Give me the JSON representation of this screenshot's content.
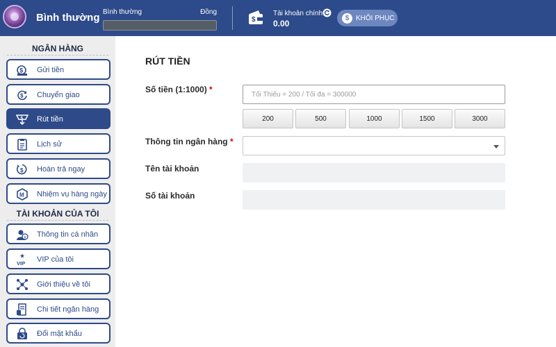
{
  "header": {
    "rank_title": "Bình thường",
    "rank_label": "Bình thường",
    "next_rank_label": "Đồng",
    "progress": 0,
    "account_label": "Tài khoản chính",
    "balance": "0.00",
    "restore_label": "KHÔI PHỤC",
    "restore_icon_text": "$"
  },
  "sidebar": {
    "bank_section": "NGÂN HÀNG",
    "bank_items": [
      {
        "label": "Gửi tiền",
        "icon": "deposit-icon"
      },
      {
        "label": "Chuyển giao",
        "icon": "transfer-icon"
      },
      {
        "label": "Rút tiền",
        "icon": "withdraw-icon",
        "active": true
      },
      {
        "label": "Lịch sử",
        "icon": "history-icon"
      },
      {
        "label": "Hoàn trả ngay",
        "icon": "rebate-icon"
      },
      {
        "label": "Nhiệm vụ hàng ngày",
        "icon": "daily-mission-icon"
      }
    ],
    "account_section": "TÀI KHOẢN CỦA TÔI",
    "account_items": [
      {
        "label": "Thông tin cá nhân",
        "icon": "profile-icon"
      },
      {
        "label": "VIP của tôi",
        "icon": "vip-icon"
      },
      {
        "label": "Giới thiệu về tôi",
        "icon": "referral-icon"
      },
      {
        "label": "Chi tiết ngân hàng",
        "icon": "bank-details-icon"
      },
      {
        "label": "Đổi mật khẩu",
        "icon": "change-password-icon"
      }
    ]
  },
  "main": {
    "title": "RÚT TIỀN",
    "amount_label": "Số tiền (1:1000)",
    "required_mark": "*",
    "amount_placeholder": "Tối Thiểu = 200 / Tối đa = 300000",
    "amount_value": "",
    "quick_amounts": [
      "200",
      "500",
      "1000",
      "1500",
      "3000"
    ],
    "bank_info_label": "Thông tin ngân hàng",
    "bank_info_value": "",
    "account_name_label": "Tên tài khoản",
    "account_name_value": "",
    "account_number_label": "Số tài khoản",
    "account_number_value": ""
  },
  "colors": {
    "header_bg": "#2d4a8a",
    "accent": "#2e4a88",
    "required": "#d0021b",
    "sidebar_bg": "#ededed"
  }
}
